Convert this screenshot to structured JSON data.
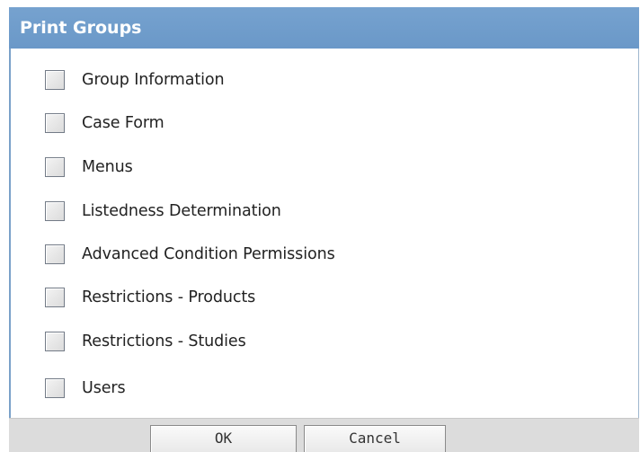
{
  "dialog": {
    "title": "Print Groups"
  },
  "options": [
    {
      "label": "Group Information",
      "checked": false
    },
    {
      "label": "Case Form",
      "checked": false
    },
    {
      "label": "Menus",
      "checked": false
    },
    {
      "label": "Listedness Determination",
      "checked": false
    },
    {
      "label": "Advanced Condition Permissions",
      "checked": false
    },
    {
      "label": "Restrictions - Products",
      "checked": false
    },
    {
      "label": "Restrictions - Studies",
      "checked": false
    },
    {
      "label": "Users",
      "checked": false
    }
  ],
  "buttons": {
    "ok_label": "OK",
    "cancel_label": "Cancel"
  },
  "colors": {
    "title_bar": "#6f9dcc",
    "title_text": "#ffffff",
    "footer": "#dcdcdc"
  }
}
